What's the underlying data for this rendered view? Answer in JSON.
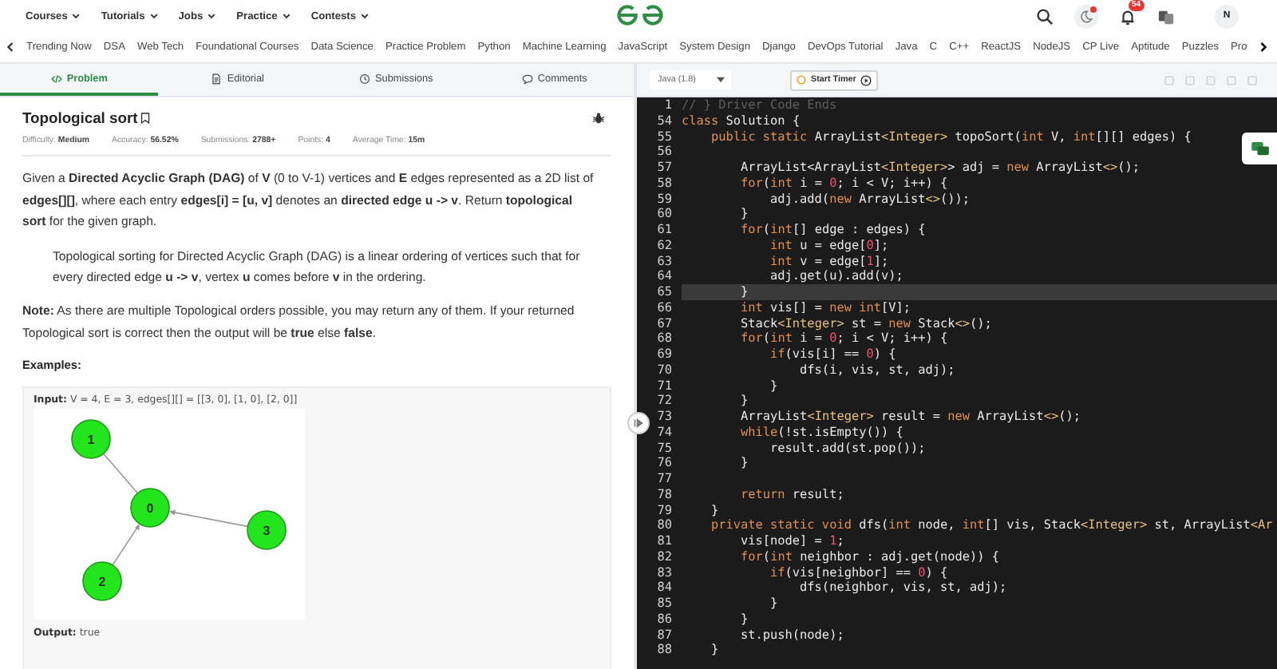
{
  "top_nav": {
    "menus": [
      "Courses",
      "Tutorials",
      "Jobs",
      "Practice",
      "Contests"
    ],
    "notification_count": "54",
    "avatar": "N"
  },
  "subnav": {
    "items": [
      "Trending Now",
      "DSA",
      "Web Tech",
      "Foundational Courses",
      "Data Science",
      "Practice Problem",
      "Python",
      "Machine Learning",
      "JavaScript",
      "System Design",
      "Django",
      "DevOps Tutorial",
      "Java",
      "C",
      "C++",
      "ReactJS",
      "NodeJS",
      "CP Live",
      "Aptitude",
      "Puzzles",
      "Pro"
    ]
  },
  "problem_tabs": [
    {
      "label": "Problem",
      "selected": true
    },
    {
      "label": "Editorial",
      "selected": false
    },
    {
      "label": "Submissions",
      "selected": false
    },
    {
      "label": "Comments",
      "selected": false
    }
  ],
  "problem": {
    "title": "Topological sort",
    "meta": [
      "Difficulty: **Medium**",
      "Accuracy: **56.52%**",
      "Submissions: **2788+**",
      "Points: **4**",
      "Average Time: **15m**"
    ],
    "statement": [
      {
        "kind": "text",
        "text": "Given a **Directed Acyclic Graph (DAG)** of **V** (0 to V-1) vertices and **E** edges represented as a 2D list of **edges[][]**, where each entry **edges[i] = [u, v]** denotes an **directed edge u -> v**. Return **topological sort** for the given graph."
      },
      {
        "kind": "quote",
        "text": "Topological sorting for Directed Acyclic Graph (DAG) is a linear ordering of vertices such that for every directed edge **u -> v**, vertex **u** comes before **v** in the ordering."
      },
      {
        "kind": "text",
        "text": "**Note:** As there are multiple Topological orders possible, you may return any of them. If your returned Topological sort is correct then the output will be **true** else **false**."
      }
    ],
    "examples_heading": "Examples:",
    "example": {
      "input": "**Input:** V = 4, E = 3, edges[][] = [[3, 0], [1, 0], [2, 0]]",
      "graph_nodes": [
        "0",
        "1",
        "2",
        "3"
      ],
      "output": "**Output:** true"
    }
  },
  "editor": {
    "language": "Java (1.8)",
    "timer_button": "Start Timer",
    "lines": [
      {
        "number": "1",
        "current": false,
        "segments": [
          {
            "kind": "comment",
            "text": "// } Driver Code Ends"
          }
        ]
      },
      {
        "number": "54",
        "current": false,
        "segments": [
          {
            "kind": "keyword",
            "text": "class"
          },
          {
            "kind": "plain",
            "text": " Solution {"
          }
        ]
      },
      {
        "number": "55",
        "current": false,
        "segments": [
          {
            "kind": "keyword",
            "text": "    public static"
          },
          {
            "kind": "plain",
            "text": " ArrayList"
          },
          {
            "kind": "type",
            "text": "<Integer>"
          },
          {
            "kind": "plain",
            "text": " topoSort("
          },
          {
            "kind": "keyword",
            "text": "int"
          },
          {
            "kind": "plain",
            "text": " V, "
          },
          {
            "kind": "keyword",
            "text": "int"
          },
          {
            "kind": "plain",
            "text": "[][] edges) {"
          }
        ]
      },
      {
        "number": "56",
        "current": false
      },
      {
        "number": "57",
        "current": false,
        "segments": [
          {
            "kind": "plain",
            "text": "        ArrayList<ArrayList"
          },
          {
            "kind": "type",
            "text": "<Integer>"
          },
          {
            "kind": "plain",
            "text": "> adj = "
          },
          {
            "kind": "keyword",
            "text": "new"
          },
          {
            "kind": "plain",
            "text": " ArrayList"
          },
          {
            "kind": "type",
            "text": "<>"
          },
          {
            "kind": "plain",
            "text": "();"
          }
        ]
      },
      {
        "number": "58",
        "current": false,
        "segments": [
          {
            "kind": "keyword",
            "text": "        for"
          },
          {
            "kind": "plain",
            "text": "("
          },
          {
            "kind": "keyword",
            "text": "int"
          },
          {
            "kind": "plain",
            "text": " i = "
          },
          {
            "kind": "number",
            "text": "0"
          },
          {
            "kind": "plain",
            "text": "; i < V; i++) {"
          }
        ]
      },
      {
        "number": "59",
        "current": false,
        "segments": [
          {
            "kind": "plain",
            "text": "            adj.add("
          },
          {
            "kind": "keyword",
            "text": "new"
          },
          {
            "kind": "plain",
            "text": " ArrayList"
          },
          {
            "kind": "type",
            "text": "<>"
          },
          {
            "kind": "plain",
            "text": "());"
          }
        ]
      },
      {
        "number": "60",
        "current": false,
        "segments": [
          {
            "kind": "plain",
            "text": "        }"
          }
        ]
      },
      {
        "number": "61",
        "current": false,
        "segments": [
          {
            "kind": "keyword",
            "text": "        for"
          },
          {
            "kind": "plain",
            "text": "("
          },
          {
            "kind": "keyword",
            "text": "int"
          },
          {
            "kind": "plain",
            "text": "[] edge : edges) {"
          }
        ]
      },
      {
        "number": "62",
        "current": false,
        "segments": [
          {
            "kind": "keyword",
            "text": "            int"
          },
          {
            "kind": "plain",
            "text": " u = edge["
          },
          {
            "kind": "number",
            "text": "0"
          },
          {
            "kind": "plain",
            "text": "];"
          }
        ]
      },
      {
        "number": "63",
        "current": false,
        "segments": [
          {
            "kind": "keyword",
            "text": "            int"
          },
          {
            "kind": "plain",
            "text": " v = edge["
          },
          {
            "kind": "number",
            "text": "1"
          },
          {
            "kind": "plain",
            "text": "];"
          }
        ]
      },
      {
        "number": "64",
        "current": false,
        "segments": [
          {
            "kind": "plain",
            "text": "            adj.get(u).add(v);"
          }
        ]
      },
      {
        "number": "65",
        "current": true,
        "segments": [
          {
            "kind": "plain",
            "text": "        }"
          }
        ]
      },
      {
        "number": "66",
        "current": false,
        "segments": [
          {
            "kind": "keyword",
            "text": "        int"
          },
          {
            "kind": "plain",
            "text": " vis[] = "
          },
          {
            "kind": "keyword",
            "text": "new int"
          },
          {
            "kind": "plain",
            "text": "[V];"
          }
        ]
      },
      {
        "number": "67",
        "current": false,
        "segments": [
          {
            "kind": "plain",
            "text": "        Stack"
          },
          {
            "kind": "type",
            "text": "<Integer>"
          },
          {
            "kind": "plain",
            "text": " st = "
          },
          {
            "kind": "keyword",
            "text": "new"
          },
          {
            "kind": "plain",
            "text": " Stack"
          },
          {
            "kind": "type",
            "text": "<>"
          },
          {
            "kind": "plain",
            "text": "();"
          }
        ]
      },
      {
        "number": "68",
        "current": false,
        "segments": [
          {
            "kind": "keyword",
            "text": "        for"
          },
          {
            "kind": "plain",
            "text": "("
          },
          {
            "kind": "keyword",
            "text": "int"
          },
          {
            "kind": "plain",
            "text": " i = "
          },
          {
            "kind": "number",
            "text": "0"
          },
          {
            "kind": "plain",
            "text": "; i < V; i++) {"
          }
        ]
      },
      {
        "number": "69",
        "current": false,
        "segments": [
          {
            "kind": "keyword",
            "text": "            if"
          },
          {
            "kind": "plain",
            "text": "(vis[i] == "
          },
          {
            "kind": "number",
            "text": "0"
          },
          {
            "kind": "plain",
            "text": ") {"
          }
        ]
      },
      {
        "number": "70",
        "current": false,
        "segments": [
          {
            "kind": "plain",
            "text": "                dfs(i, vis, st, adj);"
          }
        ]
      },
      {
        "number": "71",
        "current": false,
        "segments": [
          {
            "kind": "plain",
            "text": "            }"
          }
        ]
      },
      {
        "number": "72",
        "current": false,
        "segments": [
          {
            "kind": "plain",
            "text": "        }"
          }
        ]
      },
      {
        "number": "73",
        "current": false,
        "segments": [
          {
            "kind": "plain",
            "text": "        ArrayList"
          },
          {
            "kind": "type",
            "text": "<Integer>"
          },
          {
            "kind": "plain",
            "text": " result = "
          },
          {
            "kind": "keyword",
            "text": "new"
          },
          {
            "kind": "plain",
            "text": " ArrayList"
          },
          {
            "kind": "type",
            "text": "<>"
          },
          {
            "kind": "plain",
            "text": "();"
          }
        ]
      },
      {
        "number": "74",
        "current": false,
        "segments": [
          {
            "kind": "keyword",
            "text": "        while"
          },
          {
            "kind": "plain",
            "text": "(!st.isEmpty()) {"
          }
        ]
      },
      {
        "number": "75",
        "current": false,
        "segments": [
          {
            "kind": "plain",
            "text": "            result.add(st.pop());"
          }
        ]
      },
      {
        "number": "76",
        "current": false,
        "segments": [
          {
            "kind": "plain",
            "text": "        }"
          }
        ]
      },
      {
        "number": "77",
        "current": false
      },
      {
        "number": "78",
        "current": false,
        "segments": [
          {
            "kind": "keyword",
            "text": "        return"
          },
          {
            "kind": "plain",
            "text": " result;"
          }
        ]
      },
      {
        "number": "79",
        "current": false,
        "segments": [
          {
            "kind": "plain",
            "text": "    }"
          }
        ]
      },
      {
        "number": "80",
        "current": false,
        "segments": [
          {
            "kind": "keyword",
            "text": "    private static void"
          },
          {
            "kind": "plain",
            "text": " dfs("
          },
          {
            "kind": "keyword",
            "text": "int"
          },
          {
            "kind": "plain",
            "text": " node, "
          },
          {
            "kind": "keyword",
            "text": "int"
          },
          {
            "kind": "plain",
            "text": "[] vis, Stack"
          },
          {
            "kind": "type",
            "text": "<Integer>"
          },
          {
            "kind": "plain",
            "text": " st, ArrayList"
          },
          {
            "kind": "type",
            "text": "<Ar"
          }
        ]
      },
      {
        "number": "81",
        "current": false,
        "segments": [
          {
            "kind": "plain",
            "text": "        vis[node] = "
          },
          {
            "kind": "number",
            "text": "1"
          },
          {
            "kind": "plain",
            "text": ";"
          }
        ]
      },
      {
        "number": "82",
        "current": false,
        "segments": [
          {
            "kind": "keyword",
            "text": "        for"
          },
          {
            "kind": "plain",
            "text": "("
          },
          {
            "kind": "keyword",
            "text": "int"
          },
          {
            "kind": "plain",
            "text": " neighbor : adj.get(node)) {"
          }
        ]
      },
      {
        "number": "83",
        "current": false,
        "segments": [
          {
            "kind": "keyword",
            "text": "            if"
          },
          {
            "kind": "plain",
            "text": "(vis[neighbor] == "
          },
          {
            "kind": "number",
            "text": "0"
          },
          {
            "kind": "plain",
            "text": ") {"
          }
        ]
      },
      {
        "number": "84",
        "current": false,
        "segments": [
          {
            "kind": "plain",
            "text": "                dfs(neighbor, vis, st, adj);"
          }
        ]
      },
      {
        "number": "85",
        "current": false,
        "segments": [
          {
            "kind": "plain",
            "text": "            }"
          }
        ]
      },
      {
        "number": "86",
        "current": false,
        "segments": [
          {
            "kind": "plain",
            "text": "        }"
          }
        ]
      },
      {
        "number": "87",
        "current": false,
        "segments": [
          {
            "kind": "plain",
            "text": "        st.push(node);"
          }
        ]
      },
      {
        "number": "88",
        "current": false,
        "segments": [
          {
            "kind": "plain",
            "text": "    }"
          }
        ]
      }
    ]
  }
}
